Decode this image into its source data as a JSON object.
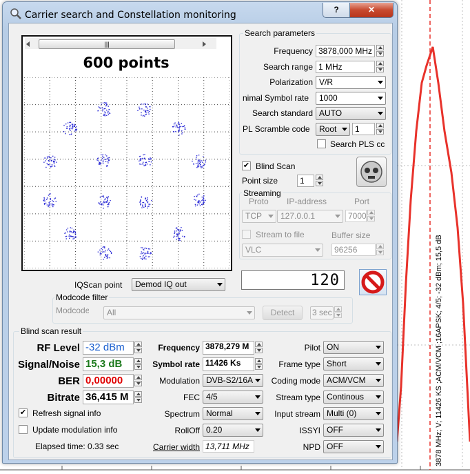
{
  "window": {
    "title": "Carrier search and Constellation monitoring",
    "help_label": "?",
    "close_label": "✕"
  },
  "background": {
    "marker_label": "3878 MHz; V; 11426 KS ;ACM/VCM ;16APSK; 4/5; -32 dBm; 15,5 dB",
    "line_color": "#e8322b"
  },
  "constellation": {
    "points_label": "600 points",
    "scroll_grip": "|||",
    "dot_color": "#2b2bd6"
  },
  "search": {
    "title": "Search parameters",
    "frequency_label": "Frequency",
    "frequency_value": "3878,000 MHz",
    "range_label": "Search range",
    "range_value": "1 MHz",
    "polarization_label": "Polarization",
    "polarization_value": "V/R",
    "symbol_label": "nimal Symbol rate",
    "symbol_value": "1000",
    "standard_label": "Search standard",
    "standard_value": "AUTO",
    "pls_label": "PL Scramble code",
    "pls_mode": "Root",
    "pls_value": "1",
    "search_pls_label": "Search PLS cc"
  },
  "blind": {
    "label": "Blind Scan",
    "point_size_label": "Point size",
    "point_size_value": "1"
  },
  "streaming": {
    "title": "Streaming",
    "proto_label": "Proto",
    "ip_label": "IP-address",
    "port_label": "Port",
    "proto_value": "TCP",
    "ip_value": "127.0.0.1",
    "port_value": "7000",
    "file_label": "Stream to file",
    "buffer_label": "Buffer size",
    "player_value": "VLC",
    "buffer_value": "96256"
  },
  "counter": {
    "value": "120"
  },
  "iqscan": {
    "label": "IQScan point",
    "value": "Demod IQ out"
  },
  "modcode": {
    "title": "Modcode filter",
    "label": "Modcode",
    "value": "All",
    "detect_label": "Detect",
    "sec_value": "3 sec"
  },
  "result": {
    "title": "Blind scan result",
    "rf_label": "RF Level",
    "rf_value": "-32 dBm",
    "snr_label": "Signal/Noise",
    "snr_value": "15,3 dB",
    "ber_label": "BER",
    "ber_value": "0,00000",
    "bitrate_label": "Bitrate",
    "bitrate_value": "36,415 M",
    "freq_label": "Frequency",
    "freq_value": "3878,279 M",
    "sr_label": "Symbol rate",
    "sr_value": "11426 Ks",
    "mod_label": "Modulation",
    "mod_value": "DVB-S2/16A",
    "fec_label": "FEC",
    "fec_value": "4/5",
    "spectrum_label": "Spectrum",
    "spectrum_value": "Normal",
    "rolloff_label": "RollOff",
    "rolloff_value": "0.20",
    "cw_label": "Carrier width",
    "cw_value": "13,711 MHz",
    "pilot_label": "Pilot",
    "pilot_value": "ON",
    "frame_label": "Frame type",
    "frame_value": "Short",
    "coding_label": "Coding mode",
    "coding_value": "ACM/VCM",
    "stype_label": "Stream type",
    "stype_value": "Continous",
    "input_label": "Input stream",
    "input_value": "Multi (0)",
    "issyi_label": "ISSYI",
    "issyi_value": "OFF",
    "npd_label": "NPD",
    "npd_value": "OFF",
    "refresh_label": "Refresh signal info",
    "update_label": "Update modulation info",
    "elapsed_label": "Elapsed time: 0.33 sec"
  },
  "colors": {
    "rf": "#1a5fcf",
    "snr": "#1d7a1d",
    "ber": "#e00000",
    "stop": "#d61a1a"
  }
}
